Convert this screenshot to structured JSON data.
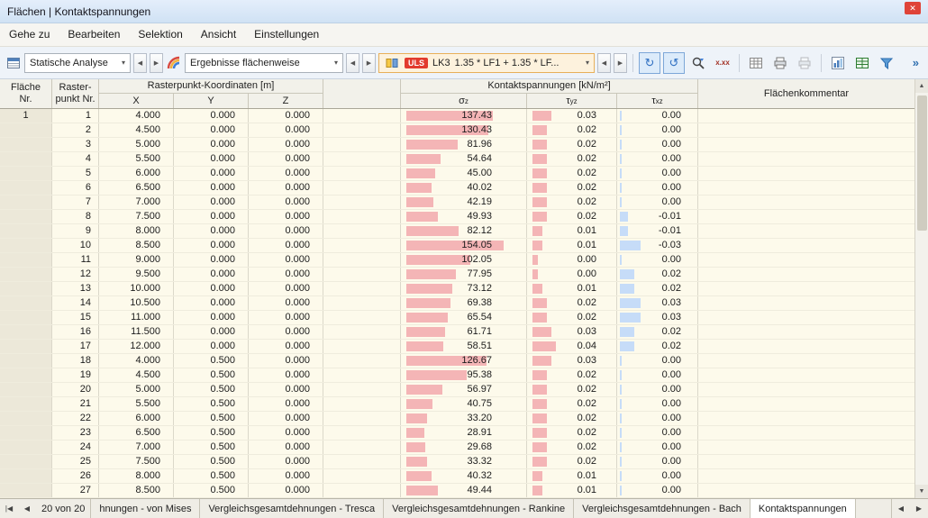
{
  "window": {
    "title": "Flächen | Kontaktspannungen",
    "close": "✕"
  },
  "menu": {
    "items": [
      "Gehe zu",
      "Bearbeiten",
      "Selektion",
      "Ansicht",
      "Einstellungen"
    ]
  },
  "toolbar": {
    "analysis_combo": "Statische Analyse",
    "results_combo": "Ergebnisse flächenweise",
    "uls_badge": "ULS",
    "lk_label": "LK3",
    "combination_combo": "1.35 * LF1 + 1.35 * LF...",
    "decimal_places_icon": "x.xx",
    "overflow": "»"
  },
  "icons": {
    "dropdown": "▾",
    "prev": "◀",
    "next": "▶",
    "first": "|◀",
    "up": "▲",
    "down": "▼",
    "redo": "↻",
    "undo": "↺"
  },
  "colors": {
    "bar_pink": "#f4b5b6",
    "bar_blue": "#c6dcf8",
    "uls_red": "#e23b2e",
    "row_cream": "#fdfaeb",
    "header_gray": "#f2f1ea"
  },
  "table": {
    "headers": {
      "col1a": "Fläche",
      "col1b": "Nr.",
      "col2a": "Raster-",
      "col2b": "punkt Nr.",
      "coords_group": "Rasterpunkt-Koordinaten [m]",
      "x": "X",
      "y": "Y",
      "z": "Z",
      "stress_group": "Kontaktspannungen [kN/m²]",
      "sigma": "σ",
      "sigma_sub": "z",
      "tyz": "τ",
      "tyz_sub": "yz",
      "txz": "τ",
      "txz_sub": "xz",
      "comment": "Flächenkommentar"
    },
    "rows": [
      {
        "flaeche": "1",
        "nr": "1",
        "x": "4.000",
        "y": "0.000",
        "z": "0.000",
        "sigma": "137.43",
        "tyz": "0.03",
        "txz": "0.00"
      },
      {
        "nr": "2",
        "x": "4.500",
        "y": "0.000",
        "z": "0.000",
        "sigma": "130.43",
        "tyz": "0.02",
        "txz": "0.00"
      },
      {
        "nr": "3",
        "x": "5.000",
        "y": "0.000",
        "z": "0.000",
        "sigma": "81.96",
        "tyz": "0.02",
        "txz": "0.00"
      },
      {
        "nr": "4",
        "x": "5.500",
        "y": "0.000",
        "z": "0.000",
        "sigma": "54.64",
        "tyz": "0.02",
        "txz": "0.00"
      },
      {
        "nr": "5",
        "x": "6.000",
        "y": "0.000",
        "z": "0.000",
        "sigma": "45.00",
        "tyz": "0.02",
        "txz": "0.00"
      },
      {
        "nr": "6",
        "x": "6.500",
        "y": "0.000",
        "z": "0.000",
        "sigma": "40.02",
        "tyz": "0.02",
        "txz": "0.00"
      },
      {
        "nr": "7",
        "x": "7.000",
        "y": "0.000",
        "z": "0.000",
        "sigma": "42.19",
        "tyz": "0.02",
        "txz": "0.00"
      },
      {
        "nr": "8",
        "x": "7.500",
        "y": "0.000",
        "z": "0.000",
        "sigma": "49.93",
        "tyz": "0.02",
        "txz": "-0.01"
      },
      {
        "nr": "9",
        "x": "8.000",
        "y": "0.000",
        "z": "0.000",
        "sigma": "82.12",
        "tyz": "0.01",
        "txz": "-0.01"
      },
      {
        "nr": "10",
        "x": "8.500",
        "y": "0.000",
        "z": "0.000",
        "sigma": "154.05",
        "tyz": "0.01",
        "txz": "-0.03"
      },
      {
        "nr": "11",
        "x": "9.000",
        "y": "0.000",
        "z": "0.000",
        "sigma": "102.05",
        "tyz": "0.00",
        "txz": "0.00"
      },
      {
        "nr": "12",
        "x": "9.500",
        "y": "0.000",
        "z": "0.000",
        "sigma": "77.95",
        "tyz": "0.00",
        "txz": "0.02"
      },
      {
        "nr": "13",
        "x": "10.000",
        "y": "0.000",
        "z": "0.000",
        "sigma": "73.12",
        "tyz": "0.01",
        "txz": "0.02"
      },
      {
        "nr": "14",
        "x": "10.500",
        "y": "0.000",
        "z": "0.000",
        "sigma": "69.38",
        "tyz": "0.02",
        "txz": "0.03"
      },
      {
        "nr": "15",
        "x": "11.000",
        "y": "0.000",
        "z": "0.000",
        "sigma": "65.54",
        "tyz": "0.02",
        "txz": "0.03"
      },
      {
        "nr": "16",
        "x": "11.500",
        "y": "0.000",
        "z": "0.000",
        "sigma": "61.71",
        "tyz": "0.03",
        "txz": "0.02"
      },
      {
        "nr": "17",
        "x": "12.000",
        "y": "0.000",
        "z": "0.000",
        "sigma": "58.51",
        "tyz": "0.04",
        "txz": "0.02"
      },
      {
        "nr": "18",
        "x": "4.000",
        "y": "0.500",
        "z": "0.000",
        "sigma": "126.67",
        "tyz": "0.03",
        "txz": "0.00"
      },
      {
        "nr": "19",
        "x": "4.500",
        "y": "0.500",
        "z": "0.000",
        "sigma": "95.38",
        "tyz": "0.02",
        "txz": "0.00"
      },
      {
        "nr": "20",
        "x": "5.000",
        "y": "0.500",
        "z": "0.000",
        "sigma": "56.97",
        "tyz": "0.02",
        "txz": "0.00"
      },
      {
        "nr": "21",
        "x": "5.500",
        "y": "0.500",
        "z": "0.000",
        "sigma": "40.75",
        "tyz": "0.02",
        "txz": "0.00"
      },
      {
        "nr": "22",
        "x": "6.000",
        "y": "0.500",
        "z": "0.000",
        "sigma": "33.20",
        "tyz": "0.02",
        "txz": "0.00"
      },
      {
        "nr": "23",
        "x": "6.500",
        "y": "0.500",
        "z": "0.000",
        "sigma": "28.91",
        "tyz": "0.02",
        "txz": "0.00"
      },
      {
        "nr": "24",
        "x": "7.000",
        "y": "0.500",
        "z": "0.000",
        "sigma": "29.68",
        "tyz": "0.02",
        "txz": "0.00"
      },
      {
        "nr": "25",
        "x": "7.500",
        "y": "0.500",
        "z": "0.000",
        "sigma": "33.32",
        "tyz": "0.02",
        "txz": "0.00"
      },
      {
        "nr": "26",
        "x": "8.000",
        "y": "0.500",
        "z": "0.000",
        "sigma": "40.32",
        "tyz": "0.01",
        "txz": "0.00"
      },
      {
        "nr": "27",
        "x": "8.500",
        "y": "0.500",
        "z": "0.000",
        "sigma": "49.44",
        "tyz": "0.01",
        "txz": "0.00"
      }
    ]
  },
  "pager": {
    "label": "20 von 20"
  },
  "tabs": [
    {
      "label": "hnungen - von Mises"
    },
    {
      "label": "Vergleichsgesamtdehnungen - Tresca"
    },
    {
      "label": "Vergleichsgesamtdehnungen - Rankine"
    },
    {
      "label": "Vergleichsgesamtdehnungen - Bach"
    },
    {
      "label": "Kontaktspannungen",
      "active": true
    }
  ]
}
